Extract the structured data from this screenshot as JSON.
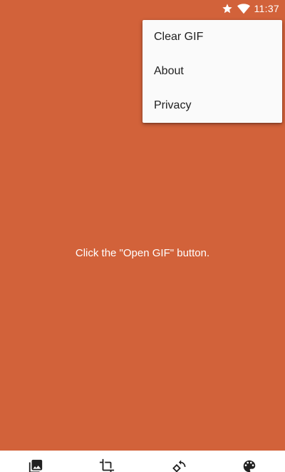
{
  "status_bar": {
    "time": "11:37",
    "icons": [
      "star-icon",
      "wifi-icon"
    ]
  },
  "menu": {
    "items": [
      {
        "label": "Clear GIF"
      },
      {
        "label": "About"
      },
      {
        "label": "Privacy"
      }
    ]
  },
  "main": {
    "hint": "Click the \"Open GIF\" button."
  },
  "bottom_bar": {
    "buttons": [
      {
        "icon": "image-icon"
      },
      {
        "icon": "crop-icon"
      },
      {
        "icon": "rotate-icon"
      },
      {
        "icon": "palette-icon"
      }
    ]
  },
  "colors": {
    "background": "#D2623A",
    "menu_background": "#FAFAFA",
    "menu_text": "#212121",
    "bottom_bar": "#FFFFFF"
  }
}
